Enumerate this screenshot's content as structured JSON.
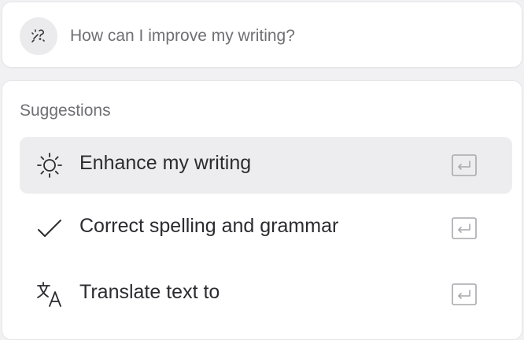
{
  "prompt": {
    "placeholder": "How can I improve my writing?",
    "icon": "ai-sparkle-icon"
  },
  "suggestions": {
    "heading": "Suggestions",
    "items": [
      {
        "label": "Enhance my writing",
        "icon": "sun-icon",
        "active": true,
        "shortcut_icon": "enter-key-icon"
      },
      {
        "label": "Correct spelling and grammar",
        "icon": "checkmark-icon",
        "active": false,
        "shortcut_icon": "enter-key-icon"
      },
      {
        "label": "Translate text to",
        "icon": "translate-icon",
        "active": false,
        "shortcut_icon": "enter-key-icon"
      }
    ]
  },
  "colors": {
    "background": "#f1f1f3",
    "card": "#ffffff",
    "active_item": "#ededef",
    "text_primary": "#2b2b30",
    "text_muted": "#6f6f74"
  }
}
